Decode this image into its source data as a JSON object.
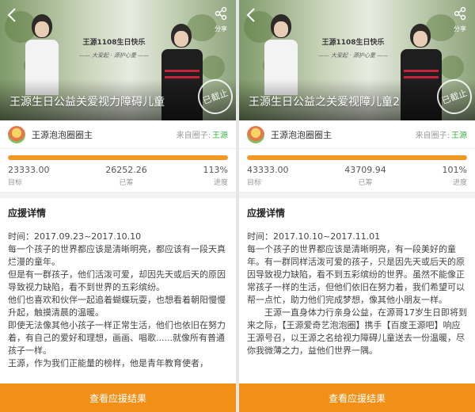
{
  "left": {
    "banner_caption_line1": "王源1108生日快乐",
    "banner_caption_line2": "—— 大爱起 · 源护心童 ——",
    "share_label": "分享",
    "title": "王源生日公益关爱视力障碍儿童",
    "stamp_text": "已截止",
    "circle_name": "王源泡泡圈圈主",
    "from_label": "来自圈子:",
    "from_value": "王源",
    "progress_fraction": 1.0,
    "target_value": "23333.00",
    "target_label": "目标",
    "raised_value": "26252.26",
    "raised_label": "已筹",
    "progress_value": "113%",
    "progress_label": "进度",
    "details_heading": "应援详情",
    "time": "时间：2017.09.23~2017.10.10",
    "paragraphs": [
      "每一个孩子的世界都应该是清晰明亮，都应该有一段天真烂漫的童年。",
      "但是有一群孩子，他们活泼可爱，却因先天或后天的原因导致视力缺陷，看不到世界的五彩缤纷。",
      "他们也喜欢和伙伴一起追着蝴蝶玩耍，也想看着朝阳慢慢升起，触摸清晨的温暖。",
      "即使无法像其他小孩子一样正常生活，他们也依旧在努力着，有自己的爱好和理想，画画、唱歌......就像所有普通孩子一样。",
      "王源，作为我们正能量的榜样，他是青年教育使者，"
    ],
    "cta_label": "查看应援结果"
  },
  "right": {
    "banner_caption_line1": "王源1108生日快乐",
    "banner_caption_line2": "—— 大爱起 · 源护心童 ——",
    "share_label": "分享",
    "title": "王源生日公益之关爱视障儿童2",
    "stamp_text": "已截止",
    "circle_name": "王源泡泡圈圈主",
    "from_label": "来自圈子:",
    "from_value": "王源",
    "progress_fraction": 1.0,
    "target_value": "43333.00",
    "target_label": "目标",
    "raised_value": "43709.94",
    "raised_label": "已筹",
    "progress_value": "101%",
    "progress_label": "进度",
    "details_heading": "应援详情",
    "time": "时间：2017.10.10~2017.11.01",
    "paragraphs": [
      "每一个孩子的世界都应该是清晰明亮，有一段美好的童年。有一群同样活泼可爱的孩子，只是因先天或后天的原因导致视力缺陷，看不到五彩缤纷的世界。虽然不能像正常孩子一样的生活，但他们依旧在努力着，我们希望可以帮一点忙，助力他们完成梦想，像其他小朋友一样。",
      "王源一直身体力行亲身公益，在源哥17岁生日即将到来之际，【王源爱奇艺泡泡圈】携手【百度王源吧】响应王源号召，以王源之名给视力障碍儿童送去一份温暖，尽你我微薄之力，益他们世界一隅。"
    ],
    "cta_label": "查看应援结果"
  }
}
